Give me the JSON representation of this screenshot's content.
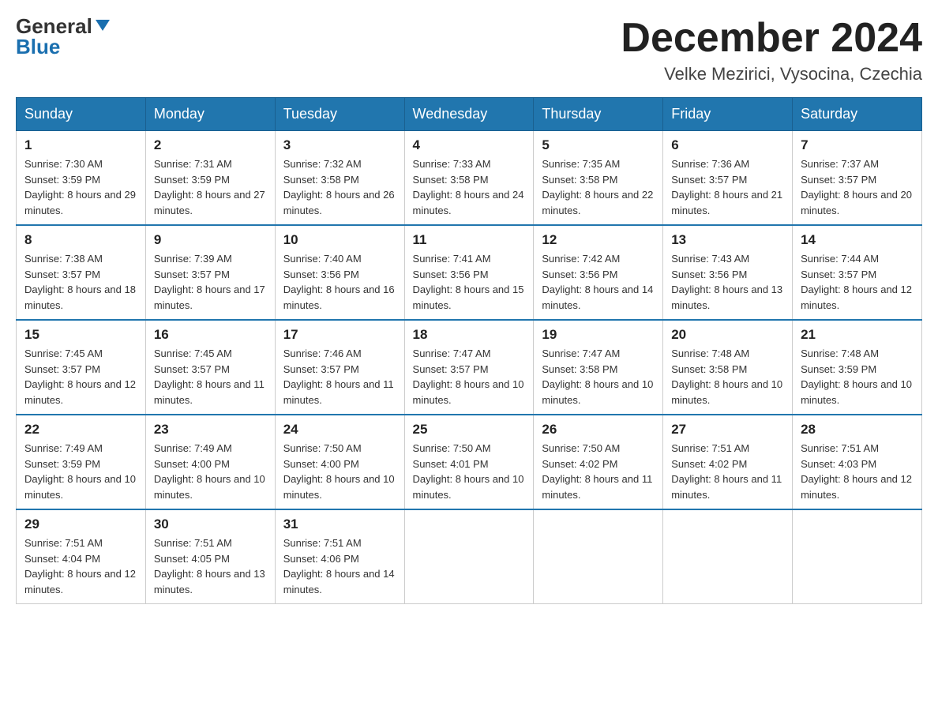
{
  "header": {
    "logo_general": "General",
    "logo_blue": "Blue",
    "month_year": "December 2024",
    "location": "Velke Mezirici, Vysocina, Czechia"
  },
  "days_of_week": [
    "Sunday",
    "Monday",
    "Tuesday",
    "Wednesday",
    "Thursday",
    "Friday",
    "Saturday"
  ],
  "weeks": [
    [
      {
        "num": "1",
        "sunrise": "7:30 AM",
        "sunset": "3:59 PM",
        "daylight": "8 hours and 29 minutes."
      },
      {
        "num": "2",
        "sunrise": "7:31 AM",
        "sunset": "3:59 PM",
        "daylight": "8 hours and 27 minutes."
      },
      {
        "num": "3",
        "sunrise": "7:32 AM",
        "sunset": "3:58 PM",
        "daylight": "8 hours and 26 minutes."
      },
      {
        "num": "4",
        "sunrise": "7:33 AM",
        "sunset": "3:58 PM",
        "daylight": "8 hours and 24 minutes."
      },
      {
        "num": "5",
        "sunrise": "7:35 AM",
        "sunset": "3:58 PM",
        "daylight": "8 hours and 22 minutes."
      },
      {
        "num": "6",
        "sunrise": "7:36 AM",
        "sunset": "3:57 PM",
        "daylight": "8 hours and 21 minutes."
      },
      {
        "num": "7",
        "sunrise": "7:37 AM",
        "sunset": "3:57 PM",
        "daylight": "8 hours and 20 minutes."
      }
    ],
    [
      {
        "num": "8",
        "sunrise": "7:38 AM",
        "sunset": "3:57 PM",
        "daylight": "8 hours and 18 minutes."
      },
      {
        "num": "9",
        "sunrise": "7:39 AM",
        "sunset": "3:57 PM",
        "daylight": "8 hours and 17 minutes."
      },
      {
        "num": "10",
        "sunrise": "7:40 AM",
        "sunset": "3:56 PM",
        "daylight": "8 hours and 16 minutes."
      },
      {
        "num": "11",
        "sunrise": "7:41 AM",
        "sunset": "3:56 PM",
        "daylight": "8 hours and 15 minutes."
      },
      {
        "num": "12",
        "sunrise": "7:42 AM",
        "sunset": "3:56 PM",
        "daylight": "8 hours and 14 minutes."
      },
      {
        "num": "13",
        "sunrise": "7:43 AM",
        "sunset": "3:56 PM",
        "daylight": "8 hours and 13 minutes."
      },
      {
        "num": "14",
        "sunrise": "7:44 AM",
        "sunset": "3:57 PM",
        "daylight": "8 hours and 12 minutes."
      }
    ],
    [
      {
        "num": "15",
        "sunrise": "7:45 AM",
        "sunset": "3:57 PM",
        "daylight": "8 hours and 12 minutes."
      },
      {
        "num": "16",
        "sunrise": "7:45 AM",
        "sunset": "3:57 PM",
        "daylight": "8 hours and 11 minutes."
      },
      {
        "num": "17",
        "sunrise": "7:46 AM",
        "sunset": "3:57 PM",
        "daylight": "8 hours and 11 minutes."
      },
      {
        "num": "18",
        "sunrise": "7:47 AM",
        "sunset": "3:57 PM",
        "daylight": "8 hours and 10 minutes."
      },
      {
        "num": "19",
        "sunrise": "7:47 AM",
        "sunset": "3:58 PM",
        "daylight": "8 hours and 10 minutes."
      },
      {
        "num": "20",
        "sunrise": "7:48 AM",
        "sunset": "3:58 PM",
        "daylight": "8 hours and 10 minutes."
      },
      {
        "num": "21",
        "sunrise": "7:48 AM",
        "sunset": "3:59 PM",
        "daylight": "8 hours and 10 minutes."
      }
    ],
    [
      {
        "num": "22",
        "sunrise": "7:49 AM",
        "sunset": "3:59 PM",
        "daylight": "8 hours and 10 minutes."
      },
      {
        "num": "23",
        "sunrise": "7:49 AM",
        "sunset": "4:00 PM",
        "daylight": "8 hours and 10 minutes."
      },
      {
        "num": "24",
        "sunrise": "7:50 AM",
        "sunset": "4:00 PM",
        "daylight": "8 hours and 10 minutes."
      },
      {
        "num": "25",
        "sunrise": "7:50 AM",
        "sunset": "4:01 PM",
        "daylight": "8 hours and 10 minutes."
      },
      {
        "num": "26",
        "sunrise": "7:50 AM",
        "sunset": "4:02 PM",
        "daylight": "8 hours and 11 minutes."
      },
      {
        "num": "27",
        "sunrise": "7:51 AM",
        "sunset": "4:02 PM",
        "daylight": "8 hours and 11 minutes."
      },
      {
        "num": "28",
        "sunrise": "7:51 AM",
        "sunset": "4:03 PM",
        "daylight": "8 hours and 12 minutes."
      }
    ],
    [
      {
        "num": "29",
        "sunrise": "7:51 AM",
        "sunset": "4:04 PM",
        "daylight": "8 hours and 12 minutes."
      },
      {
        "num": "30",
        "sunrise": "7:51 AM",
        "sunset": "4:05 PM",
        "daylight": "8 hours and 13 minutes."
      },
      {
        "num": "31",
        "sunrise": "7:51 AM",
        "sunset": "4:06 PM",
        "daylight": "8 hours and 14 minutes."
      },
      null,
      null,
      null,
      null
    ]
  ]
}
